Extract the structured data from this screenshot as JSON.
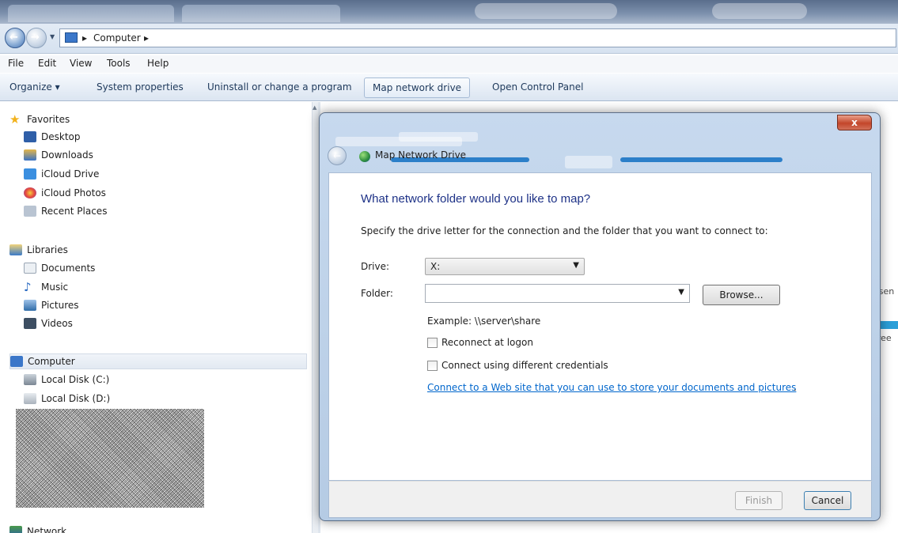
{
  "address_bar": {
    "crumbs": [
      "Computer"
    ]
  },
  "menu": [
    "File",
    "Edit",
    "View",
    "Tools",
    "Help"
  ],
  "command_bar": {
    "organize": "Organize ▾",
    "system_properties": "System properties",
    "uninstall": "Uninstall or change a program",
    "map_network_drive": "Map network drive",
    "open_control_panel": "Open Control Panel"
  },
  "nav": {
    "favorites": "Favorites",
    "desktop": "Desktop",
    "downloads": "Downloads",
    "icloud_drive": "iCloud Drive",
    "icloud_photos": "iCloud Photos",
    "recent_places": "Recent Places",
    "libraries": "Libraries",
    "documents": "Documents",
    "music": "Music",
    "pictures": "Pictures",
    "videos": "Videos",
    "computer": "Computer",
    "local_c": "Local Disk (C:)",
    "local_d": "Local Disk (D:)",
    "network": "Network"
  },
  "content_partial": {
    "ssen": "ssen",
    "free": "free"
  },
  "dialog": {
    "close": "x",
    "title": "Map Network Drive",
    "heading": "What network folder would you like to map?",
    "instruction": "Specify the drive letter for the connection and the folder that you want to connect to:",
    "drive_label": "Drive:",
    "drive_value": "X:",
    "folder_label": "Folder:",
    "folder_value": "",
    "browse": "Browse...",
    "example": "Example: \\\\server\\share",
    "reconnect": "Reconnect at logon",
    "different_credentials": "Connect using different credentials",
    "web_link": "Connect to a Web site that you can use to store your documents and pictures",
    "web_link_suffix": ".",
    "finish": "Finish",
    "cancel": "Cancel"
  }
}
